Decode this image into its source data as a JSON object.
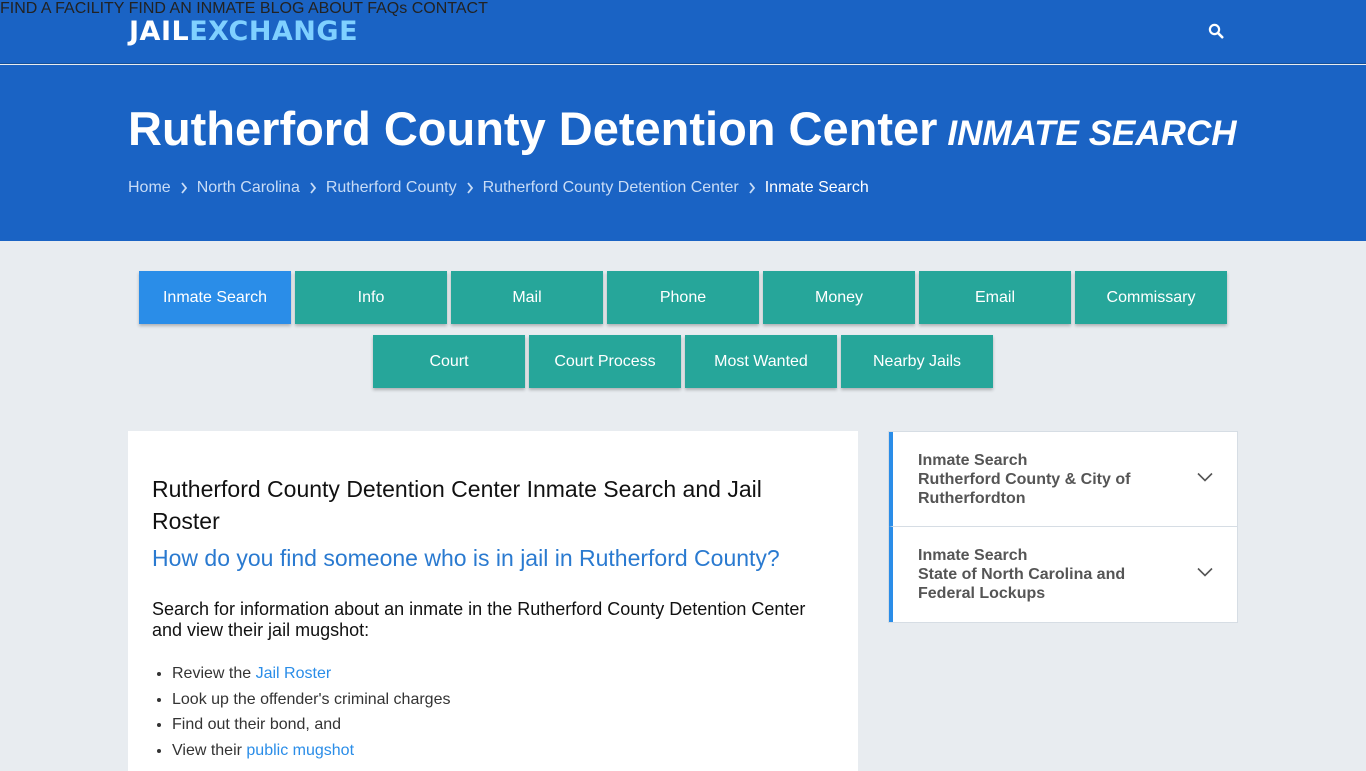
{
  "brand": {
    "part1": "JAIL",
    "part2": "EXCHANGE"
  },
  "nav": {
    "items": [
      "FIND A FACILITY",
      "FIND AN INMATE",
      "BLOG",
      "ABOUT",
      "FAQs",
      "CONTACT"
    ],
    "search_icon": "search-icon"
  },
  "hero": {
    "title": "Rutherford County Detention Center",
    "subtitle": "INMATE SEARCH",
    "breadcrumbs": [
      "Home",
      "North Carolina",
      "Rutherford County",
      "Rutherford County Detention Center",
      "Inmate Search"
    ]
  },
  "tabs": {
    "row1": [
      "Inmate Search",
      "Info",
      "Mail",
      "Phone",
      "Money",
      "Email",
      "Commissary"
    ],
    "row2": [
      "Court",
      "Court Process",
      "Most Wanted",
      "Nearby Jails"
    ]
  },
  "main": {
    "heading": "Rutherford County Detention Center Inmate Search and Jail Roster",
    "question": "How do you find someone who is in jail in Rutherford County?",
    "lead": "Search for information about an inmate in the Rutherford County Detention Center and view their jail mugshot:",
    "list": [
      {
        "text": "Review the ",
        "link": "Jail Roster"
      },
      {
        "text": "Look up the offender's criminal charges",
        "link": ""
      },
      {
        "text": "Find out their bond, and",
        "link": ""
      },
      {
        "text": "View their ",
        "link": "public mugshot"
      }
    ]
  },
  "sidebar": {
    "items": [
      {
        "title": "Inmate Search",
        "sub": "Rutherford County & City of Rutherfordton"
      },
      {
        "title": "Inmate Search",
        "sub": "State of North Carolina and Federal Lockups"
      }
    ]
  },
  "colors": {
    "header_blue": "#1a63c4",
    "tab_teal": "#26a69a",
    "tab_active": "#2a8de8",
    "link_blue": "#2a8de8"
  }
}
